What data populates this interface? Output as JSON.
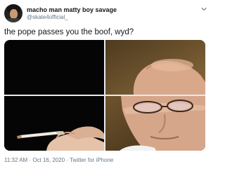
{
  "tweet": {
    "display_name": "macho man matty boy savage",
    "handle": "@skate4official_",
    "text": "the pope passes you the boof, wyd?",
    "timestamp": "11:32 AM · Oct 16, 2020",
    "separator": " · ",
    "source": "Twitter for iPhone",
    "icons": {
      "avatar": "profile-photo",
      "menu": "chevron-down-icon"
    },
    "media": {
      "layout": "2x2 collage",
      "panels": [
        "black-background",
        "pope-head-top",
        "hand-holding-joint",
        "pope-face-bottom"
      ]
    }
  },
  "colors": {
    "text_primary": "#14171a",
    "text_secondary": "#657786",
    "background": "#ffffff"
  }
}
